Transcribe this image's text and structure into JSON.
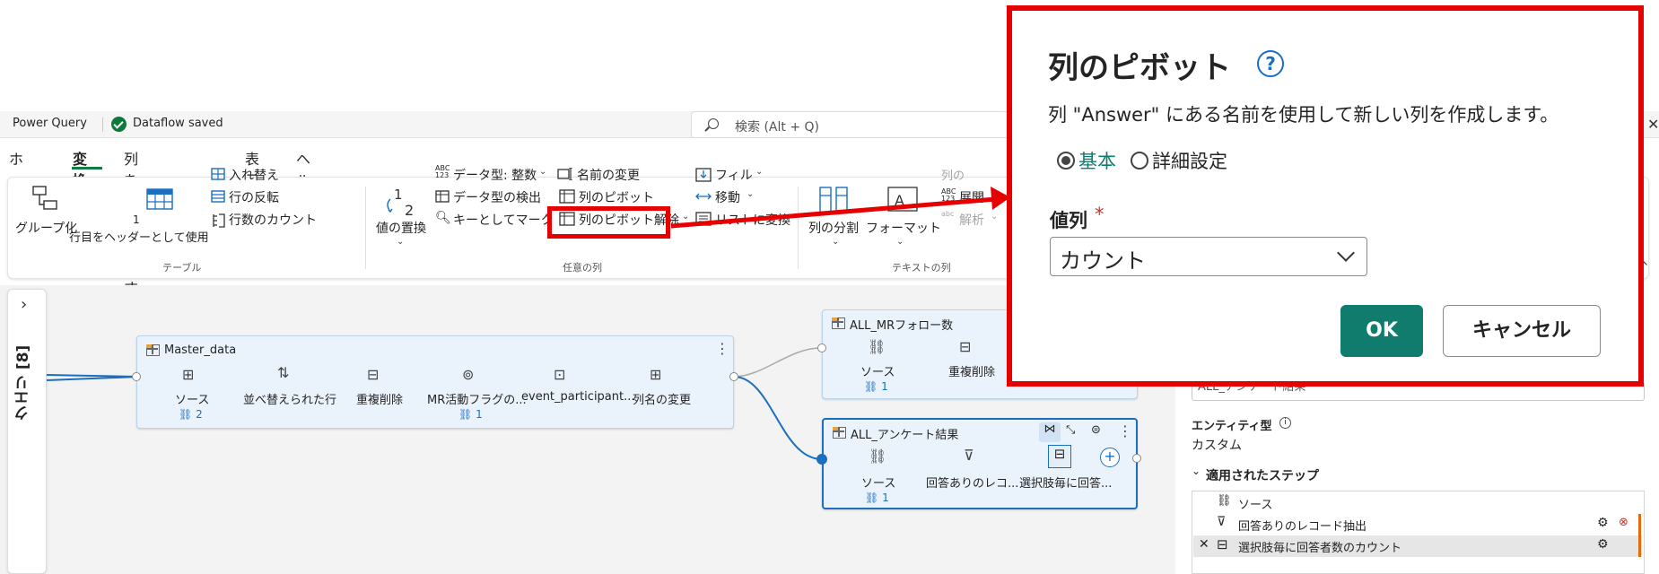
{
  "titlebar": {
    "app_name": "Power Query",
    "status": "Dataflow saved"
  },
  "search": {
    "placeholder": "検索 (Alt + Q)"
  },
  "tabs": [
    {
      "label": "ホーム"
    },
    {
      "label": "変換",
      "active": true
    },
    {
      "label": "列を追加します"
    },
    {
      "label": "表示"
    },
    {
      "label": "ヘルプ"
    }
  ],
  "ribbon": {
    "table": {
      "group_by": "グループ化",
      "first_row_num": "1",
      "use_first_row_headers": "行目をヘッダーとして使用",
      "transpose": "入れ替え",
      "reverse_rows": "行の反転",
      "count_rows": "行数のカウント",
      "group_label": "テーブル"
    },
    "any_column": {
      "replace_values": "値の置換",
      "data_type": "データ型: 整数",
      "data_type_abc": "ABC",
      "data_type_123": "123",
      "detect_type": "データ型の検出",
      "mark_as_key": "キーとしてマーク",
      "rename": "名前の変更",
      "pivot_column": "列のピボット",
      "unpivot_columns": "列のピボット解除",
      "fill": "フィル",
      "move": "移動",
      "convert_to_list": "リストに変換",
      "group_label": "任意の列"
    },
    "text_column": {
      "split_column": "列の分割",
      "format": "フォーマット",
      "extract": "展開",
      "extract_abc": "ABC",
      "extract_123": "123",
      "parse": "解析",
      "parse_abc": "abc",
      "partial": "列の",
      "group_label": "テキストの列"
    }
  },
  "queries_panel": {
    "label": "クエリ [8]"
  },
  "nodes": {
    "master": {
      "title": "Master_data",
      "steps": [
        "ソース",
        "並べ替えられた行",
        "重複削除",
        "MR活動フラグの...",
        "event_participant...",
        "列名の変更"
      ],
      "link_left": "2",
      "link_right": "1"
    },
    "mr_follow": {
      "title": "ALL_MRフォロー数",
      "steps": [
        "ソース",
        "重複削除"
      ],
      "link": "1"
    },
    "survey": {
      "title": "ALL_アンケート結果",
      "steps": [
        "ソース",
        "回答ありのレコ...",
        "選択肢毎に回答..."
      ],
      "link": "1"
    }
  },
  "right_pane": {
    "name_value": "ALL_アンケート結果",
    "entity_type_label": "エンティティ型",
    "entity_type_value": "カスタム",
    "applied_steps_label": "適用されたステップ",
    "steps": [
      {
        "label": "ソース"
      },
      {
        "label": "回答ありのレコード抽出"
      },
      {
        "label": "選択肢毎に回答者数のカウント",
        "selected": true
      }
    ]
  },
  "dialog": {
    "title": "列のピボット",
    "help": "?",
    "description": "列 \"Answer\" にある名前を使用して新しい列を作成します。",
    "radio_basic": "基本",
    "radio_advanced": "詳細設定",
    "value_column_label": "値列",
    "required_mark": "*",
    "value_column_selected": "カウント",
    "ok": "OK",
    "cancel": "キャンセル"
  },
  "colors": {
    "accent": "#107c41",
    "ok_button": "#107c6e",
    "annotation": "#e60000",
    "link": "#1a6fbf"
  }
}
